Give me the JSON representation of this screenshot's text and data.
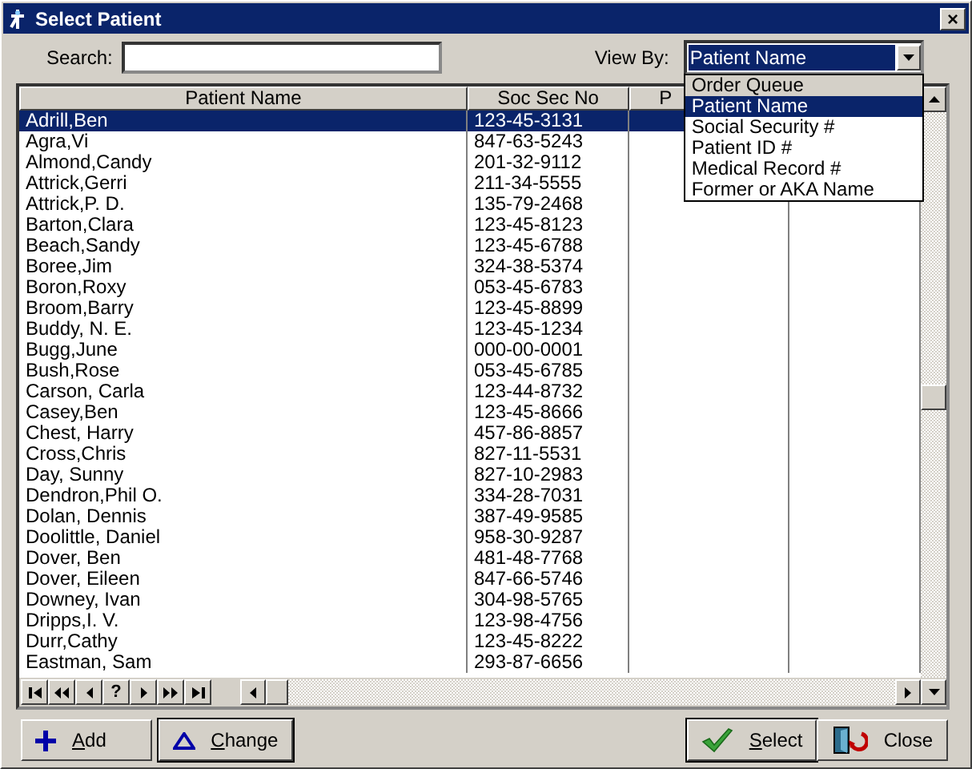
{
  "window": {
    "title": "Select Patient",
    "close": "×"
  },
  "search": {
    "label": "Search:"
  },
  "view_by": {
    "label": "View By:",
    "value": "Patient Name",
    "expanded": true,
    "options": [
      {
        "label": "Order Queue",
        "selected": false
      },
      {
        "label": "Patient Name",
        "selected": true
      },
      {
        "label": "Social Security #",
        "selected": false
      },
      {
        "label": "Patient ID #",
        "selected": false
      },
      {
        "label": "Medical Record #",
        "selected": false
      },
      {
        "label": "Former or AKA Name",
        "selected": false
      }
    ]
  },
  "table": {
    "columns": [
      "Patient Name",
      "Soc Sec No",
      "P"
    ],
    "rows": [
      {
        "name": "Adrill,Ben",
        "ssn": "123-45-3131",
        "selected": true
      },
      {
        "name": "Agra,Vi",
        "ssn": "847-63-5243",
        "selected": false
      },
      {
        "name": "Almond,Candy",
        "ssn": "201-32-9112",
        "selected": false
      },
      {
        "name": "Attrick,Gerri",
        "ssn": "211-34-5555",
        "selected": false
      },
      {
        "name": "Attrick,P. D.",
        "ssn": "135-79-2468",
        "selected": false
      },
      {
        "name": "Barton,Clara",
        "ssn": "123-45-8123",
        "selected": false
      },
      {
        "name": "Beach,Sandy",
        "ssn": "123-45-6788",
        "selected": false
      },
      {
        "name": "Boree,Jim",
        "ssn": "324-38-5374",
        "selected": false
      },
      {
        "name": "Boron,Roxy",
        "ssn": "053-45-6783",
        "selected": false
      },
      {
        "name": "Broom,Barry",
        "ssn": "123-45-8899",
        "selected": false
      },
      {
        "name": "Buddy, N. E.",
        "ssn": "123-45-1234",
        "selected": false
      },
      {
        "name": "Bugg,June",
        "ssn": "000-00-0001",
        "selected": false
      },
      {
        "name": "Bush,Rose",
        "ssn": "053-45-6785",
        "selected": false
      },
      {
        "name": "Carson, Carla",
        "ssn": "123-44-8732",
        "selected": false
      },
      {
        "name": "Casey,Ben",
        "ssn": "123-45-8666",
        "selected": false
      },
      {
        "name": "Chest, Harry",
        "ssn": "457-86-8857",
        "selected": false
      },
      {
        "name": "Cross,Chris",
        "ssn": "827-11-5531",
        "selected": false
      },
      {
        "name": "Day, Sunny",
        "ssn": "827-10-2983",
        "selected": false
      },
      {
        "name": "Dendron,Phil O.",
        "ssn": "334-28-7031",
        "selected": false
      },
      {
        "name": "Dolan, Dennis",
        "ssn": "387-49-9585",
        "selected": false
      },
      {
        "name": "Doolittle, Daniel",
        "ssn": "958-30-9287",
        "selected": false
      },
      {
        "name": "Dover, Ben",
        "ssn": "481-48-7768",
        "selected": false
      },
      {
        "name": "Dover, Eileen",
        "ssn": "847-66-5746",
        "selected": false
      },
      {
        "name": "Downey, Ivan",
        "ssn": "304-98-5765",
        "selected": false
      },
      {
        "name": "Dripps,I. V.",
        "ssn": "123-98-4756",
        "selected": false
      },
      {
        "name": "Durr,Cathy",
        "ssn": "123-45-8222",
        "selected": false
      },
      {
        "name": "Eastman, Sam",
        "ssn": "293-87-6656",
        "selected": false
      }
    ]
  },
  "navigator": [
    {
      "kind": "first"
    },
    {
      "kind": "prev-page"
    },
    {
      "kind": "prev"
    },
    {
      "kind": "find",
      "label": "?"
    },
    {
      "kind": "next"
    },
    {
      "kind": "next-page"
    },
    {
      "kind": "last"
    }
  ],
  "buttons": [
    {
      "kind": "add",
      "label": "Add",
      "underline_first": true
    },
    {
      "kind": "change",
      "label": "Change",
      "underline_first": true
    },
    {
      "kind": "select",
      "label": "Select",
      "underline_first": true
    },
    {
      "kind": "close",
      "label": "Close",
      "underline_first": false
    }
  ]
}
